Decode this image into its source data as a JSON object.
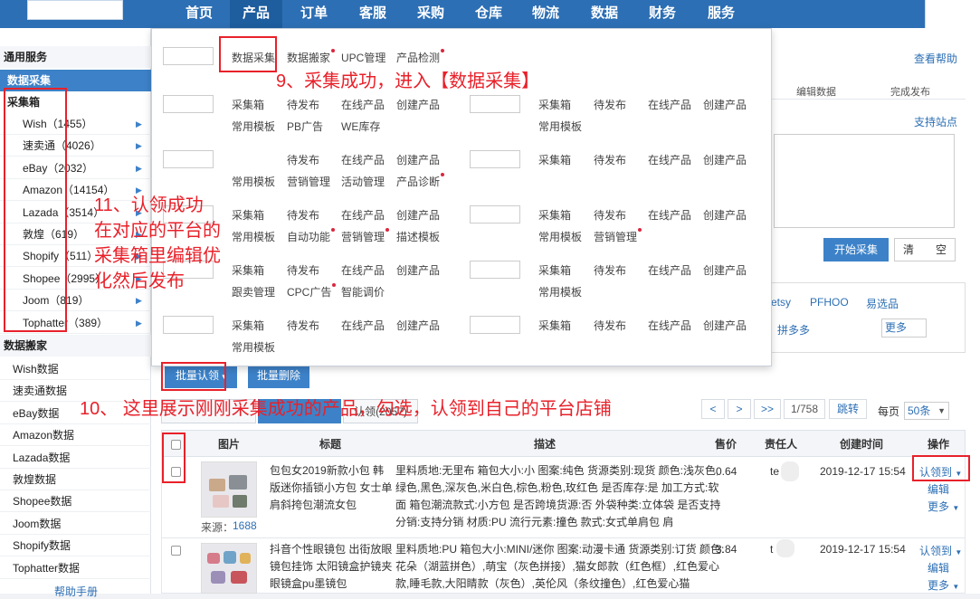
{
  "nav": {
    "items": [
      "首页",
      "产品",
      "订单",
      "客服",
      "采购",
      "仓库",
      "物流",
      "数据",
      "财务",
      "服务"
    ],
    "active": "产品"
  },
  "sidebar": {
    "section1": "通用服务",
    "active_item": "数据采集",
    "box_title": "采集箱",
    "platforms": [
      {
        "label": "Wish（1455）"
      },
      {
        "label": "速卖通（4026）"
      },
      {
        "label": "eBay（2032）"
      },
      {
        "label": "Amazon（14154）"
      },
      {
        "label": "Lazada（3514）"
      },
      {
        "label": "敦煌（619）"
      },
      {
        "label": "Shopify（511）"
      },
      {
        "label": "Shopee（2995）"
      },
      {
        "label": "Joom（819）"
      },
      {
        "label": "Tophatter（389）"
      }
    ],
    "section2": "数据搬家",
    "data_items": [
      "Wish数据",
      "速卖通数据",
      "eBay数据",
      "Amazon数据",
      "Lazada数据",
      "敦煌数据",
      "Shopee数据",
      "Joom数据",
      "Shopify数据",
      "Tophatter数据"
    ],
    "help": "帮助手册"
  },
  "mega_menu": {
    "row1": [
      {
        "label": "数据采集",
        "dot": false
      },
      {
        "label": "数据搬家",
        "dot": true
      },
      {
        "label": "UPC管理",
        "dot": false
      },
      {
        "label": "产品检测",
        "dot": true
      }
    ],
    "left_groups": [
      {
        "line1": [
          "采集箱",
          "待发布",
          "在线产品",
          "创建产品"
        ],
        "line2": [
          {
            "label": "常用模板",
            "dot": false
          },
          {
            "label": "PB广告",
            "dot": false
          },
          {
            "label": "WE库存",
            "dot": false
          }
        ]
      },
      {
        "line1": [
          "待发布",
          "在线产品",
          "创建产品"
        ],
        "line2": [
          {
            "label": "常用模板",
            "dot": false
          },
          {
            "label": "营销管理",
            "dot": false
          },
          {
            "label": "活动管理",
            "dot": false
          },
          {
            "label": "产品诊断",
            "dot": true
          }
        ]
      },
      {
        "line1": [
          "采集箱",
          "待发布",
          "在线产品",
          "创建产品"
        ],
        "line2": [
          {
            "label": "常用模板",
            "dot": false
          },
          {
            "label": "自动功能",
            "dot": true
          },
          {
            "label": "营销管理",
            "dot": true
          },
          {
            "label": "描述模板",
            "dot": false
          }
        ]
      },
      {
        "line1": [
          "采集箱",
          "待发布",
          "在线产品",
          "创建产品"
        ],
        "line2": [
          {
            "label": "跟卖管理",
            "dot": false
          },
          {
            "label": "CPC广告",
            "dot": true
          },
          {
            "label": "智能调价",
            "dot": false
          }
        ]
      },
      {
        "line1": [
          "采集箱",
          "待发布",
          "在线产品",
          "创建产品"
        ],
        "line2": [
          {
            "label": "常用模板",
            "dot": false
          }
        ]
      }
    ],
    "right_groups": [
      {
        "line1": [
          "采集箱",
          "待发布",
          "在线产品",
          "创建产品"
        ],
        "line2": [
          {
            "label": "常用模板",
            "dot": false
          }
        ]
      },
      {
        "line1": [
          "采集箱",
          "待发布",
          "在线产品",
          "创建产品"
        ],
        "line2": []
      },
      {
        "line1": [
          "采集箱",
          "待发布",
          "在线产品",
          "创建产品"
        ],
        "line2": [
          {
            "label": "常用模板",
            "dot": false
          },
          {
            "label": "营销管理",
            "dot": true
          }
        ]
      },
      {
        "line1": [
          "采集箱",
          "待发布",
          "在线产品",
          "创建产品"
        ],
        "line2": [
          {
            "label": "常用模板",
            "dot": false
          }
        ]
      },
      {
        "line1": [
          "采集箱",
          "待发布",
          "在线产品",
          "创建产品"
        ],
        "line2": []
      }
    ]
  },
  "main": {
    "help_link": "查看帮助",
    "edit_tab": "编辑数据",
    "publish_tab": "完成发布",
    "support_link": "支持站点",
    "start_button": "开始采集",
    "clear_button": "清　　空",
    "sites": [
      "etsy",
      "PFHOO",
      "易选品",
      "拼多多"
    ],
    "more_label": "更多"
  },
  "toolbar": {
    "batch_claim": "批量认领",
    "batch_delete": "批量删除",
    "tab_partial": "认领(2057)",
    "pager_prev": "<",
    "pager_next": ">",
    "pager_last": ">>",
    "page_info": "1/758",
    "jump": "跳转",
    "per_page_label": "每页",
    "per_page_value": "50条"
  },
  "table": {
    "headers": {
      "image": "图片",
      "title": "标题",
      "desc": "描述",
      "price": "售价",
      "owner": "责任人",
      "created": "创建时间",
      "ops": "操作"
    },
    "rows": [
      {
        "source_label": "来源：",
        "source_value": "1688",
        "title": "包包女2019新款小包 韩版迷你插锁小方包 女士单肩斜挎包潮流女包",
        "desc": "里料质地:无里布 箱包大小:小 图案:纯色 货源类别:现货 颜色:浅灰色,绿色,黑色,深灰色,米白色,棕色,粉色,玫红色 是否库存:是 加工方式:软面 箱包潮流款式:小方包 是否跨境货源:否 外袋种类:立体袋 是否支持分销:支持分销 材质:PU 流行元素:撞色 款式:女式单肩包 肩",
        "price": "0.64",
        "owner": "te",
        "created": "2019-12-17 15:54",
        "claim": "认领到",
        "edit": "编辑",
        "more": "更多"
      },
      {
        "title": "抖音个性眼镜包 出街放眼镜包挂饰 太阳镜盒护镜夹眼镜盒pu墨镜包",
        "desc": "里料质地:PU 箱包大小:MINI/迷你 图案:动漫卡通 货源类别:订货 颜色:花朵（湖蓝拼色）,萌宝（灰色拼接）,猫女郎款（红色框）,红色爱心款,睡毛款,大阳睛款（灰色）,英伦风（条纹撞色）,红色爱心猫",
        "price": "3.84",
        "owner": "t",
        "created": "2019-12-17 15:54",
        "claim": "认领到",
        "edit": "编辑",
        "more": "更多"
      }
    ]
  },
  "annotations": {
    "step9": "9、采集成功，进入【数据采集】",
    "step10": "10、 这里展示刚刚采集成功的产品，勾选，认领到自己的平台店铺",
    "step11_lines": [
      "11、认领成功",
      "在对应的平台的",
      "采集箱里编辑优",
      "化然后发布"
    ]
  },
  "colors": {
    "nav": "#2d6fb4",
    "accent": "#3d82c8",
    "annotation": "#e8212a",
    "dot": "#d9283f"
  }
}
